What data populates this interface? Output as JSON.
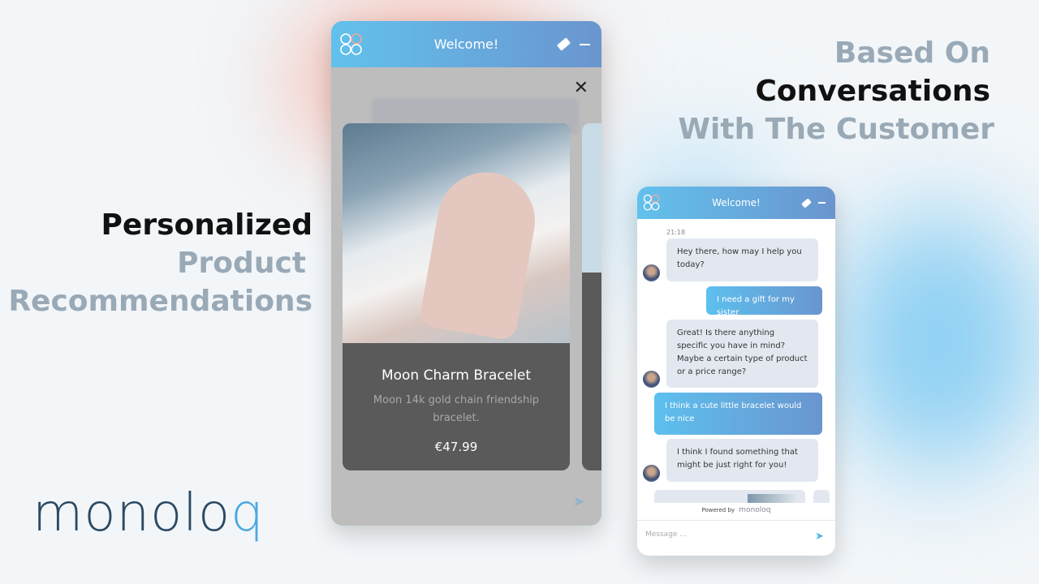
{
  "left_heading": [
    "Personalized",
    "Product",
    "Recommendations"
  ],
  "right_heading": [
    "Based On",
    "Conversations",
    "With The Customer"
  ],
  "brand": {
    "logo_main": "monolo",
    "logo_last": "q",
    "color": "#2b4a63",
    "accent": "#4aa8e0"
  },
  "widget_large": {
    "title": "Welcome!",
    "product": {
      "name": "Moon Charm Bracelet",
      "description": "Moon 14k gold chain friendship bracelet.",
      "price": "€47.99"
    }
  },
  "widget_small": {
    "title": "Welcome!",
    "time": "21:18",
    "messages": [
      {
        "from": "bot",
        "text": "Hey there, how may I help you today?"
      },
      {
        "from": "user",
        "text": "I need a gift for my sister"
      },
      {
        "from": "bot",
        "text": "Great! Is there anything specific you have in mind? Maybe a certain type of product or a price range?"
      },
      {
        "from": "user",
        "text": "I think a cute little bracelet would be nice"
      },
      {
        "from": "bot",
        "text": "I think I found something that might be just right for you!"
      }
    ],
    "powered_by": "Powered by",
    "powered_brand": "monoloq",
    "message_placeholder": "Message ..."
  }
}
